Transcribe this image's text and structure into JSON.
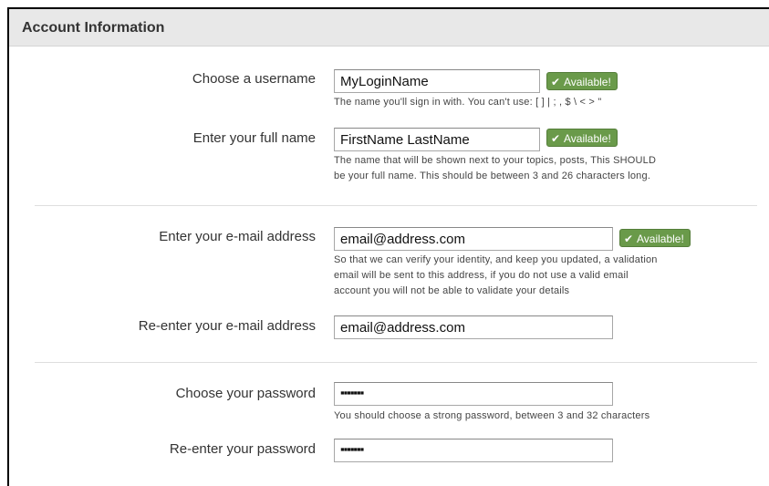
{
  "section": {
    "title": "Account Information"
  },
  "fields": {
    "username": {
      "label": "Choose a username",
      "value": "MyLoginName",
      "badge": "Available!",
      "hint": "The name you'll sign in with. You can't use: [ ] | ; , $ \\ < > \""
    },
    "fullname": {
      "label": "Enter your full name",
      "value": "FirstName LastName",
      "badge": "Available!",
      "hint_line1": "The name that will be shown next to your topics, posts, This SHOULD",
      "hint_line2": "be your full name. This should be between 3 and 26 characters long."
    },
    "email": {
      "label": "Enter your e-mail address",
      "value": "email@address.com",
      "badge": "Available!",
      "hint_line1": "So that we can verify your identity, and keep you updated, a validation",
      "hint_line2": "email will be sent to this address, if you do not use a valid email",
      "hint_line3": "account you will not be able to validate your details"
    },
    "email_confirm": {
      "label": "Re-enter your e-mail address",
      "value": "email@address.com"
    },
    "password": {
      "label": "Choose your password",
      "value": "▪▪▪▪▪▪▪",
      "hint": "You should choose a strong password, between 3 and 32 characters"
    },
    "password_confirm": {
      "label": "Re-enter your password",
      "value": "▪▪▪▪▪▪▪"
    }
  },
  "icons": {
    "badge_check": "✔"
  },
  "colors": {
    "badge_green": "#6a9a4a",
    "header_bg": "#e8e8e8"
  }
}
